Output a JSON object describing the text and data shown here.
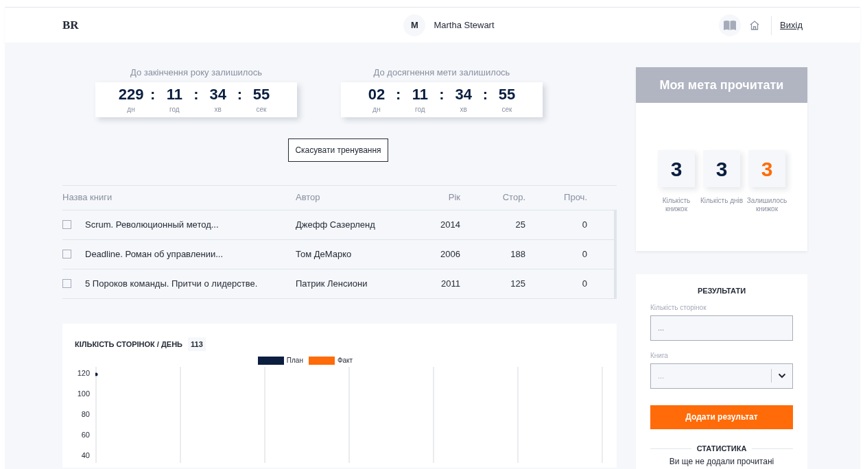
{
  "header": {
    "logo": "BR",
    "avatar_letter": "M",
    "user_name": "Martha Stewart",
    "logout": "Вихід"
  },
  "timers": [
    {
      "title": "До закінчення року залишилось",
      "units": [
        {
          "value": "229",
          "label": "дн"
        },
        {
          "value": "11",
          "label": "год"
        },
        {
          "value": "34",
          "label": "хв"
        },
        {
          "value": "55",
          "label": "сек"
        }
      ]
    },
    {
      "title": "До досягнення мети залишилось",
      "units": [
        {
          "value": "02",
          "label": "дн"
        },
        {
          "value": "11",
          "label": "год"
        },
        {
          "value": "34",
          "label": "хв"
        },
        {
          "value": "55",
          "label": "сек"
        }
      ]
    }
  ],
  "separator": ":",
  "cancel_button": "Скасувати тренування",
  "table": {
    "columns": [
      "Назва книги",
      "Автор",
      "Рік",
      "Стор.",
      "Проч."
    ],
    "rows": [
      {
        "checked": false,
        "cells": [
          "Scrum. Революционный метод...",
          "Джефф Сазерленд",
          "2014",
          "25",
          "0"
        ]
      },
      {
        "checked": false,
        "cells": [
          "Deadline. Роман об управлении...",
          "Том ДеМарко",
          "2006",
          "188",
          "0"
        ]
      },
      {
        "checked": false,
        "cells": [
          "5 Пороков команды. Притчи о лидерстве.",
          "Патрик Ленсиони",
          "2011",
          "125",
          "0"
        ]
      }
    ]
  },
  "chart": {
    "title": "КІЛЬКІСТЬ СТОРІНОК / ДЕНЬ",
    "badge": "113",
    "legend": [
      {
        "name": "План",
        "color": "#0b1e3f"
      },
      {
        "name": "Факт",
        "color": "#ff6b08"
      }
    ],
    "y_axis_labels": [
      "120",
      "100",
      "80",
      "60",
      "40"
    ]
  },
  "goal": {
    "title": "Моя мета прочитати",
    "stats": [
      {
        "value": "3",
        "label": "Кількість книжок",
        "color": "#0b1e3f"
      },
      {
        "value": "3",
        "label": "Кількість днів",
        "color": "#0b1e3f"
      },
      {
        "value": "3",
        "label": "Залишилось книжок",
        "color": "#ff6b08"
      }
    ]
  },
  "results": {
    "title": "РЕЗУЛЬТАТИ",
    "pages_label": "Кількість сторінок",
    "pages_placeholder": "...",
    "book_label": "Книга",
    "book_placeholder": "...",
    "add_button": "Додати результат",
    "stats_title": "СТАТИСТИКА",
    "stats_text": "Ви ще не додали прочитані"
  }
}
